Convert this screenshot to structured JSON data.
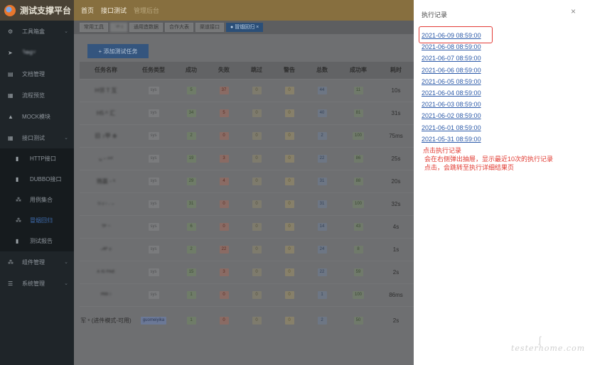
{
  "app": {
    "title": "测试支撑平台",
    "top_nav": [
      "首页",
      "接口测试",
      "管理后台"
    ]
  },
  "sidebar": {
    "items": [
      {
        "icon": "gear-icon",
        "glyph": "⚙",
        "label": "工具箱盒",
        "chevron": true
      },
      {
        "icon": "send-icon",
        "glyph": "➤",
        "label": "ꟻ𝗼𝐠˅",
        "blurred": true
      },
      {
        "icon": "doc-icon",
        "glyph": "▤",
        "label": "文档管理"
      },
      {
        "icon": "flow-icon",
        "glyph": "▦",
        "label": "流程预览"
      },
      {
        "icon": "mock-icon",
        "glyph": "▲",
        "label": "MOCK模块"
      },
      {
        "icon": "grid-icon",
        "glyph": "▦",
        "label": "接口测试",
        "chevron": true
      },
      {
        "icon": "http-icon",
        "glyph": "▮",
        "label": "HTTP接口",
        "sub": true
      },
      {
        "icon": "dubbo-icon",
        "glyph": "▮",
        "label": "DUBBO接口",
        "sub": true
      },
      {
        "icon": "cases-icon",
        "glyph": "⁂",
        "label": "用例集合",
        "sub": true
      },
      {
        "icon": "regression-icon",
        "glyph": "⁂",
        "label": "冒烟回归",
        "sub": true,
        "active": true
      },
      {
        "icon": "report-icon",
        "glyph": "▮",
        "label": "测试报告",
        "sub": true
      },
      {
        "icon": "component-icon",
        "glyph": "⁂",
        "label": "组件管理",
        "chevron": true
      },
      {
        "icon": "system-icon",
        "glyph": "☰",
        "label": "系统管理",
        "chevron": true
      }
    ]
  },
  "tabs": [
    {
      "label": "常用工具"
    },
    {
      "label": "˙ᵃʰ ᵡ",
      "blurred": true
    },
    {
      "label": "通用造数据"
    },
    {
      "label": "合作大表"
    },
    {
      "label": "渠道接口"
    },
    {
      "label": "● 冒烟回归 ×",
      "active": true
    }
  ],
  "toolbar": {
    "add_label": "+ 添加测试任务"
  },
  "table": {
    "headers": [
      "任务名称",
      "任务类型",
      "成功",
      "失败",
      "跳过",
      "警告",
      "总数",
      "成功率",
      "耗时"
    ],
    "rows": [
      {
        "name": "H邻 T 互",
        "blurred": true,
        "type": "sys",
        "ok": "5",
        "fail": "37",
        "skip": "0",
        "warn": "0",
        "total": "44",
        "rate": "11",
        "time": "10s"
      },
      {
        "name": "H5·ʰ 汇",
        "blurred": true,
        "type": "sys",
        "ok": "34",
        "fail": "5",
        "skip": "0",
        "warn": "0",
        "total": "40",
        "rate": "81",
        "time": "31s"
      },
      {
        "name": "旧 ↕甲 ⊕",
        "blurred": true,
        "type": "sys",
        "ok": "2",
        "fail": "0",
        "skip": "0",
        "warn": "0",
        "total": "2",
        "rate": "100",
        "time": "75ms"
      },
      {
        "name": "ᵢᵤ ᵕ ᵘⁿᵗ",
        "blurred": true,
        "type": "sys",
        "ok": "19",
        "fail": "3",
        "skip": "0",
        "warn": "0",
        "total": "22",
        "rate": "86",
        "time": "25s"
      },
      {
        "name": "赂赢 ᵕ ᵏ",
        "blurred": true,
        "type": "sys",
        "ok": "29",
        "fail": "4",
        "skip": "0",
        "warn": "0",
        "total": "31",
        "rate": "88",
        "time": "20s"
      },
      {
        "name": "ᵁ·ᵞ ᶦ · ᵕ",
        "blurred": true,
        "type": "sys",
        "ok": "31",
        "fail": "0",
        "skip": "0",
        "warn": "0",
        "total": "31",
        "rate": "100",
        "time": "32s"
      },
      {
        "name": "ᵀᴾ ᵔ",
        "blurred": true,
        "type": "sys",
        "ok": "6",
        "fail": "0",
        "skip": "0",
        "warn": "0",
        "total": "14",
        "rate": "43",
        "time": "4s"
      },
      {
        "name": "ᵕᴬᴾ ᵖ",
        "blurred": true,
        "type": "sys",
        "ok": "2",
        "fail": "22",
        "skip": "0",
        "warn": "0",
        "total": "24",
        "rate": "8",
        "time": "1s"
      },
      {
        "name": "ᴬ ᴵᴳ ᴾᴬᶦᴱ",
        "blurred": true,
        "type": "sys",
        "ok": "15",
        "fail": "3",
        "skip": "0",
        "warn": "0",
        "total": "22",
        "rate": "59",
        "time": "2s"
      },
      {
        "name": "ᴾᴿᴿ ᴵ",
        "blurred": true,
        "type": "sys",
        "ok": "1",
        "fail": "0",
        "skip": "0",
        "warn": "0",
        "total": "1",
        "rate": "100",
        "time": "86ms"
      },
      {
        "name": "军 ᵉ (进件模式-可用)",
        "type": "guomeiyika",
        "type_blue": true,
        "ok": "1",
        "fail": "0",
        "skip": "0",
        "warn": "0",
        "total": "2",
        "rate": "50",
        "time": "2s",
        "last": true
      }
    ]
  },
  "drawer": {
    "title": "执行记录",
    "close": "×",
    "records": [
      "2021-06-09 08:59:00",
      "2021-06-08 08:59:00",
      "2021-06-07 08:59:00",
      "2021-06-06 08:59:00",
      "2021-06-05 08:59:00",
      "2021-06-04 08:59:00",
      "2021-06-03 08:59:00",
      "2021-06-02 08:59:00",
      "2021-06-01 08:59:00",
      "2021-05-31 08:59:00"
    ],
    "note_lines": [
      "点击执行记录",
      "会在右侧弹出抽屉，显示最近10次的执行记录",
      "点击，会跳转至执行详细结果页"
    ]
  },
  "watermark": "testerhome.com",
  "colors": {
    "highlight": "#e23a35",
    "link": "#2b59a8",
    "note": "#e1382f",
    "topnav": "#876f3f"
  }
}
